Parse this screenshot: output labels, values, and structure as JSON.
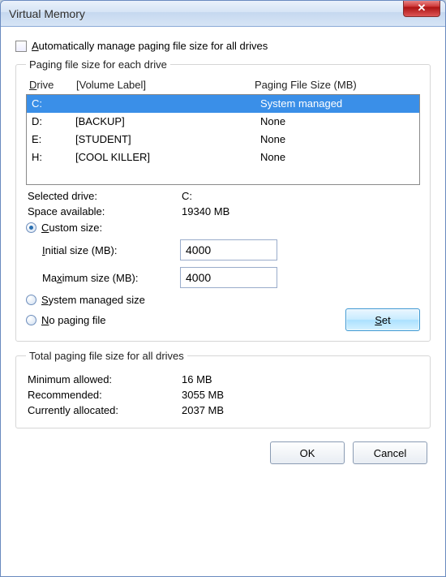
{
  "window": {
    "title": "Virtual Memory"
  },
  "auto_manage": {
    "label_pre": "A",
    "label_post": "utomatically manage paging file size for all drives",
    "checked": false
  },
  "group1": {
    "legend": "Paging file size for each drive",
    "header_drive_u": "D",
    "header_drive_rest": "rive",
    "header_vol": "[Volume Label]",
    "header_pfs": "Paging File Size (MB)",
    "drives": [
      {
        "letter": "C:",
        "vol": "",
        "status": "System managed",
        "selected": true
      },
      {
        "letter": "D:",
        "vol": "[BACKUP]",
        "status": "None",
        "selected": false
      },
      {
        "letter": "E:",
        "vol": "[STUDENT]",
        "status": "None",
        "selected": false
      },
      {
        "letter": "H:",
        "vol": "[COOL KILLER]",
        "status": "None",
        "selected": false
      }
    ],
    "selected_drive_label": "Selected drive:",
    "selected_drive_value": "C:",
    "space_avail_label": "Space available:",
    "space_avail_value": "19340 MB",
    "custom_u": "C",
    "custom_rest": "ustom size:",
    "initial_u": "I",
    "initial_rest": "nitial size (MB):",
    "initial_value": "4000",
    "max_label_pre": "Ma",
    "max_u": "x",
    "max_label_post": "imum size (MB):",
    "max_value": "4000",
    "sys_managed_u": "S",
    "sys_managed_rest": "ystem managed size",
    "no_paging_u": "N",
    "no_paging_rest": "o paging file",
    "set_u": "S",
    "set_rest": "et",
    "size_mode": "custom"
  },
  "group2": {
    "legend": "Total paging file size for all drives",
    "min_label": "Minimum allowed:",
    "min_value": "16 MB",
    "rec_label": "Recommended:",
    "rec_value": "3055 MB",
    "cur_label": "Currently allocated:",
    "cur_value": "2037 MB"
  },
  "footer": {
    "ok": "OK",
    "cancel": "Cancel"
  }
}
